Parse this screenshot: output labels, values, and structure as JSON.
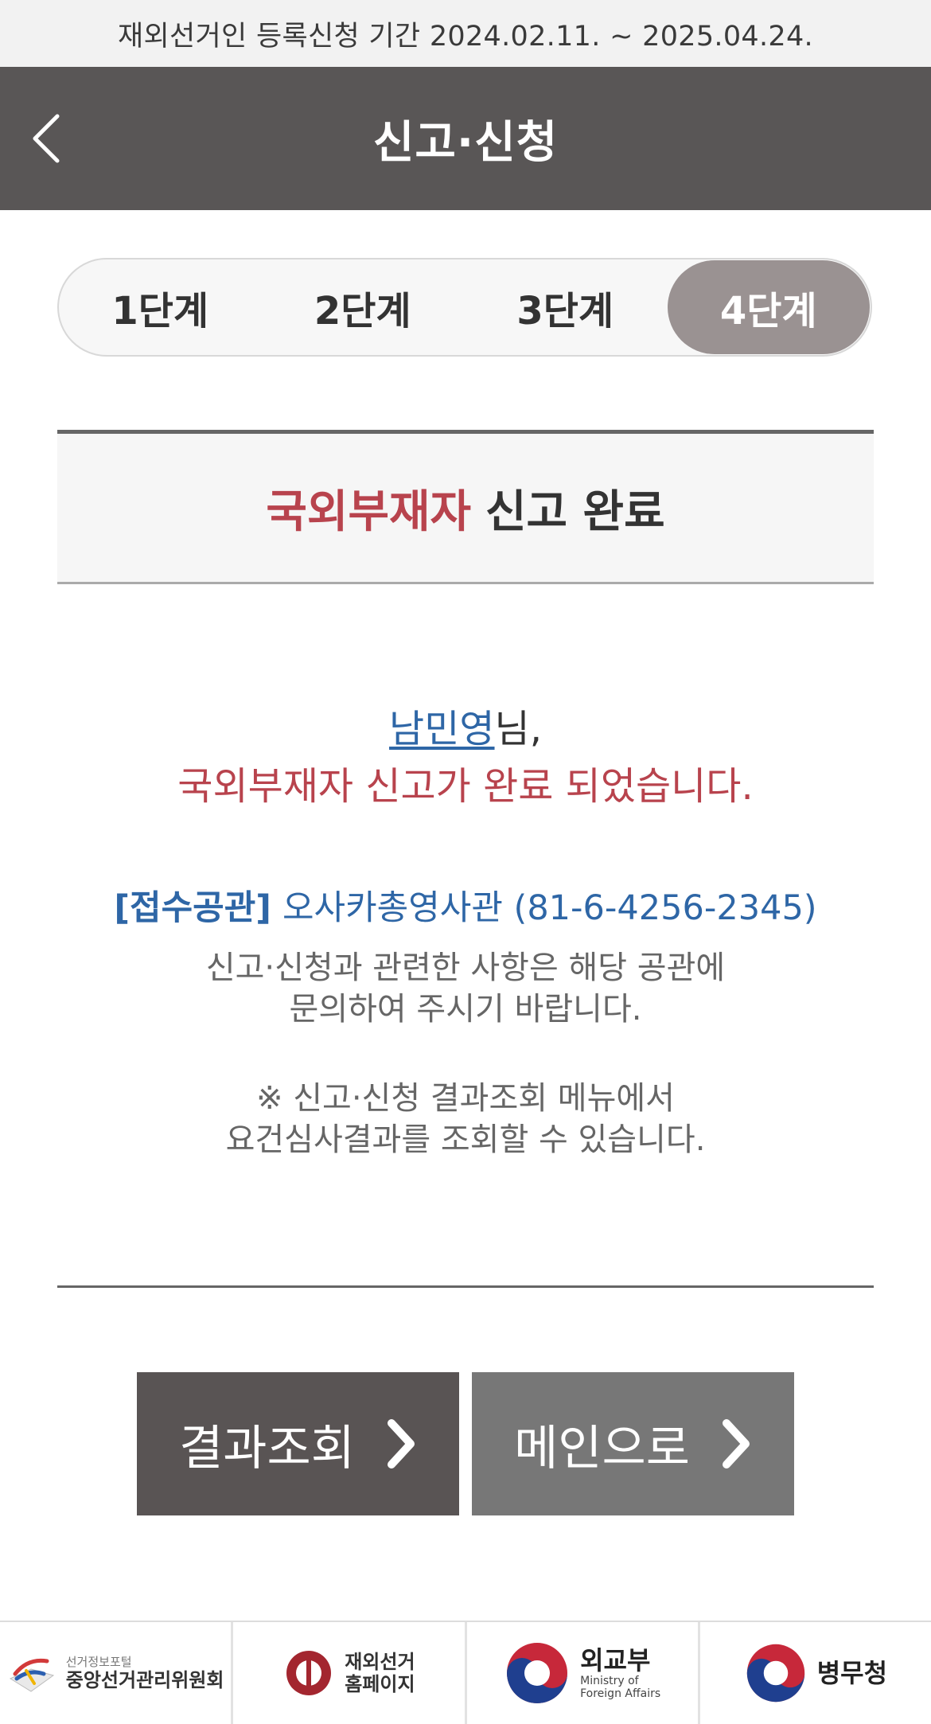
{
  "notice": "재외선거인 등록신청 기간 2024.02.11. ~ 2025.04.24.",
  "header": {
    "title": "신고·신청"
  },
  "steps": [
    {
      "label": "1단계",
      "active": false
    },
    {
      "label": "2단계",
      "active": false
    },
    {
      "label": "3단계",
      "active": false
    },
    {
      "label": "4단계",
      "active": true
    }
  ],
  "result": {
    "title_red": "국외부재자",
    "title_rest": "신고 완료"
  },
  "message": {
    "name": "남민영",
    "name_suffix": "님,",
    "done": "국외부재자 신고가 완료 되었습니다.",
    "office_label": "[접수공관]",
    "office_value": "오사카총영사관 (81-6-4256-2345)",
    "guide_line1": "신고·신청과 관련한 사항은 해당 공관에",
    "guide_line2": "문의하여 주시기 바랍니다.",
    "note_line1": "※ 신고·신청 결과조회 메뉴에서",
    "note_line2": "요건심사결과를 조회할 수 있습니다."
  },
  "buttons": {
    "result": "결과조회",
    "main": "메인으로"
  },
  "footer": {
    "nec_small": "선거정보포털",
    "nec_main": "중앙선거관리위원회",
    "overseas_line1": "재외선거",
    "overseas_line2": "홈페이지",
    "mofa_main": "외교부",
    "mofa_en1": "Ministry of",
    "mofa_en2": "Foreign Affairs",
    "mma": "병무청"
  },
  "colors": {
    "header": "#595656",
    "accent_red": "#b8434d",
    "accent_blue": "#2e66a6",
    "active_step": "#9a9292"
  }
}
